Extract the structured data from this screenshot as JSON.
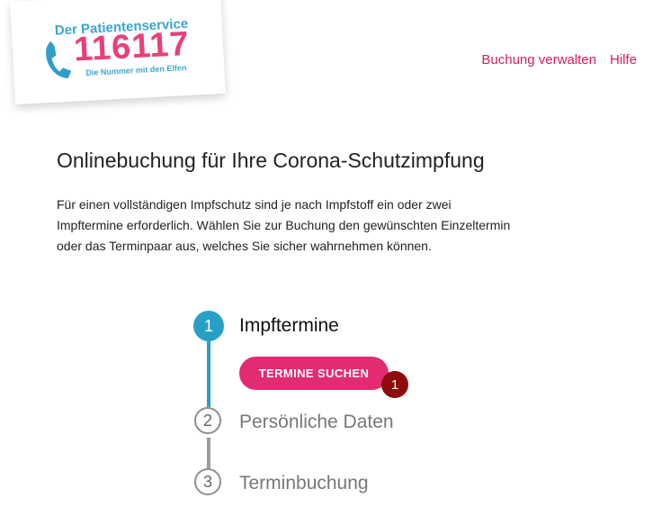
{
  "logo": {
    "title": "Der Patientenservice",
    "number": "116117",
    "subtitle": "Die Nummer mit den Elfen"
  },
  "nav": {
    "manage_booking": "Buchung verwalten",
    "help": "Hilfe"
  },
  "main": {
    "title": "Onlinebuchung für Ihre Corona-Schutzimpfung",
    "intro_lines": [
      "Für einen vollständigen Impfschutz sind je nach Impfstoff ein oder zwei",
      "Impftermine erforderlich. Wählen Sie zur Buchung den gewünschten Einzeltermin",
      "oder das Terminpaar aus, welches Sie sicher wahrnehmen können."
    ]
  },
  "steps": [
    {
      "number": "1",
      "label": "Impftermine",
      "active": true
    },
    {
      "number": "2",
      "label": "Persönliche Daten",
      "active": false
    },
    {
      "number": "3",
      "label": "Terminbuchung",
      "active": false
    }
  ],
  "search_button": {
    "label": "TERMINE SUCHEN"
  },
  "badge": {
    "value": "1"
  },
  "colors": {
    "accent_pink": "#e32b73",
    "link_pink": "#d81b60",
    "step_active_blue": "#27a0c6",
    "step_inactive_gray": "#8f8f8f",
    "badge_red": "#8f0c0c"
  },
  "icons": {
    "phone": "phone-icon"
  }
}
